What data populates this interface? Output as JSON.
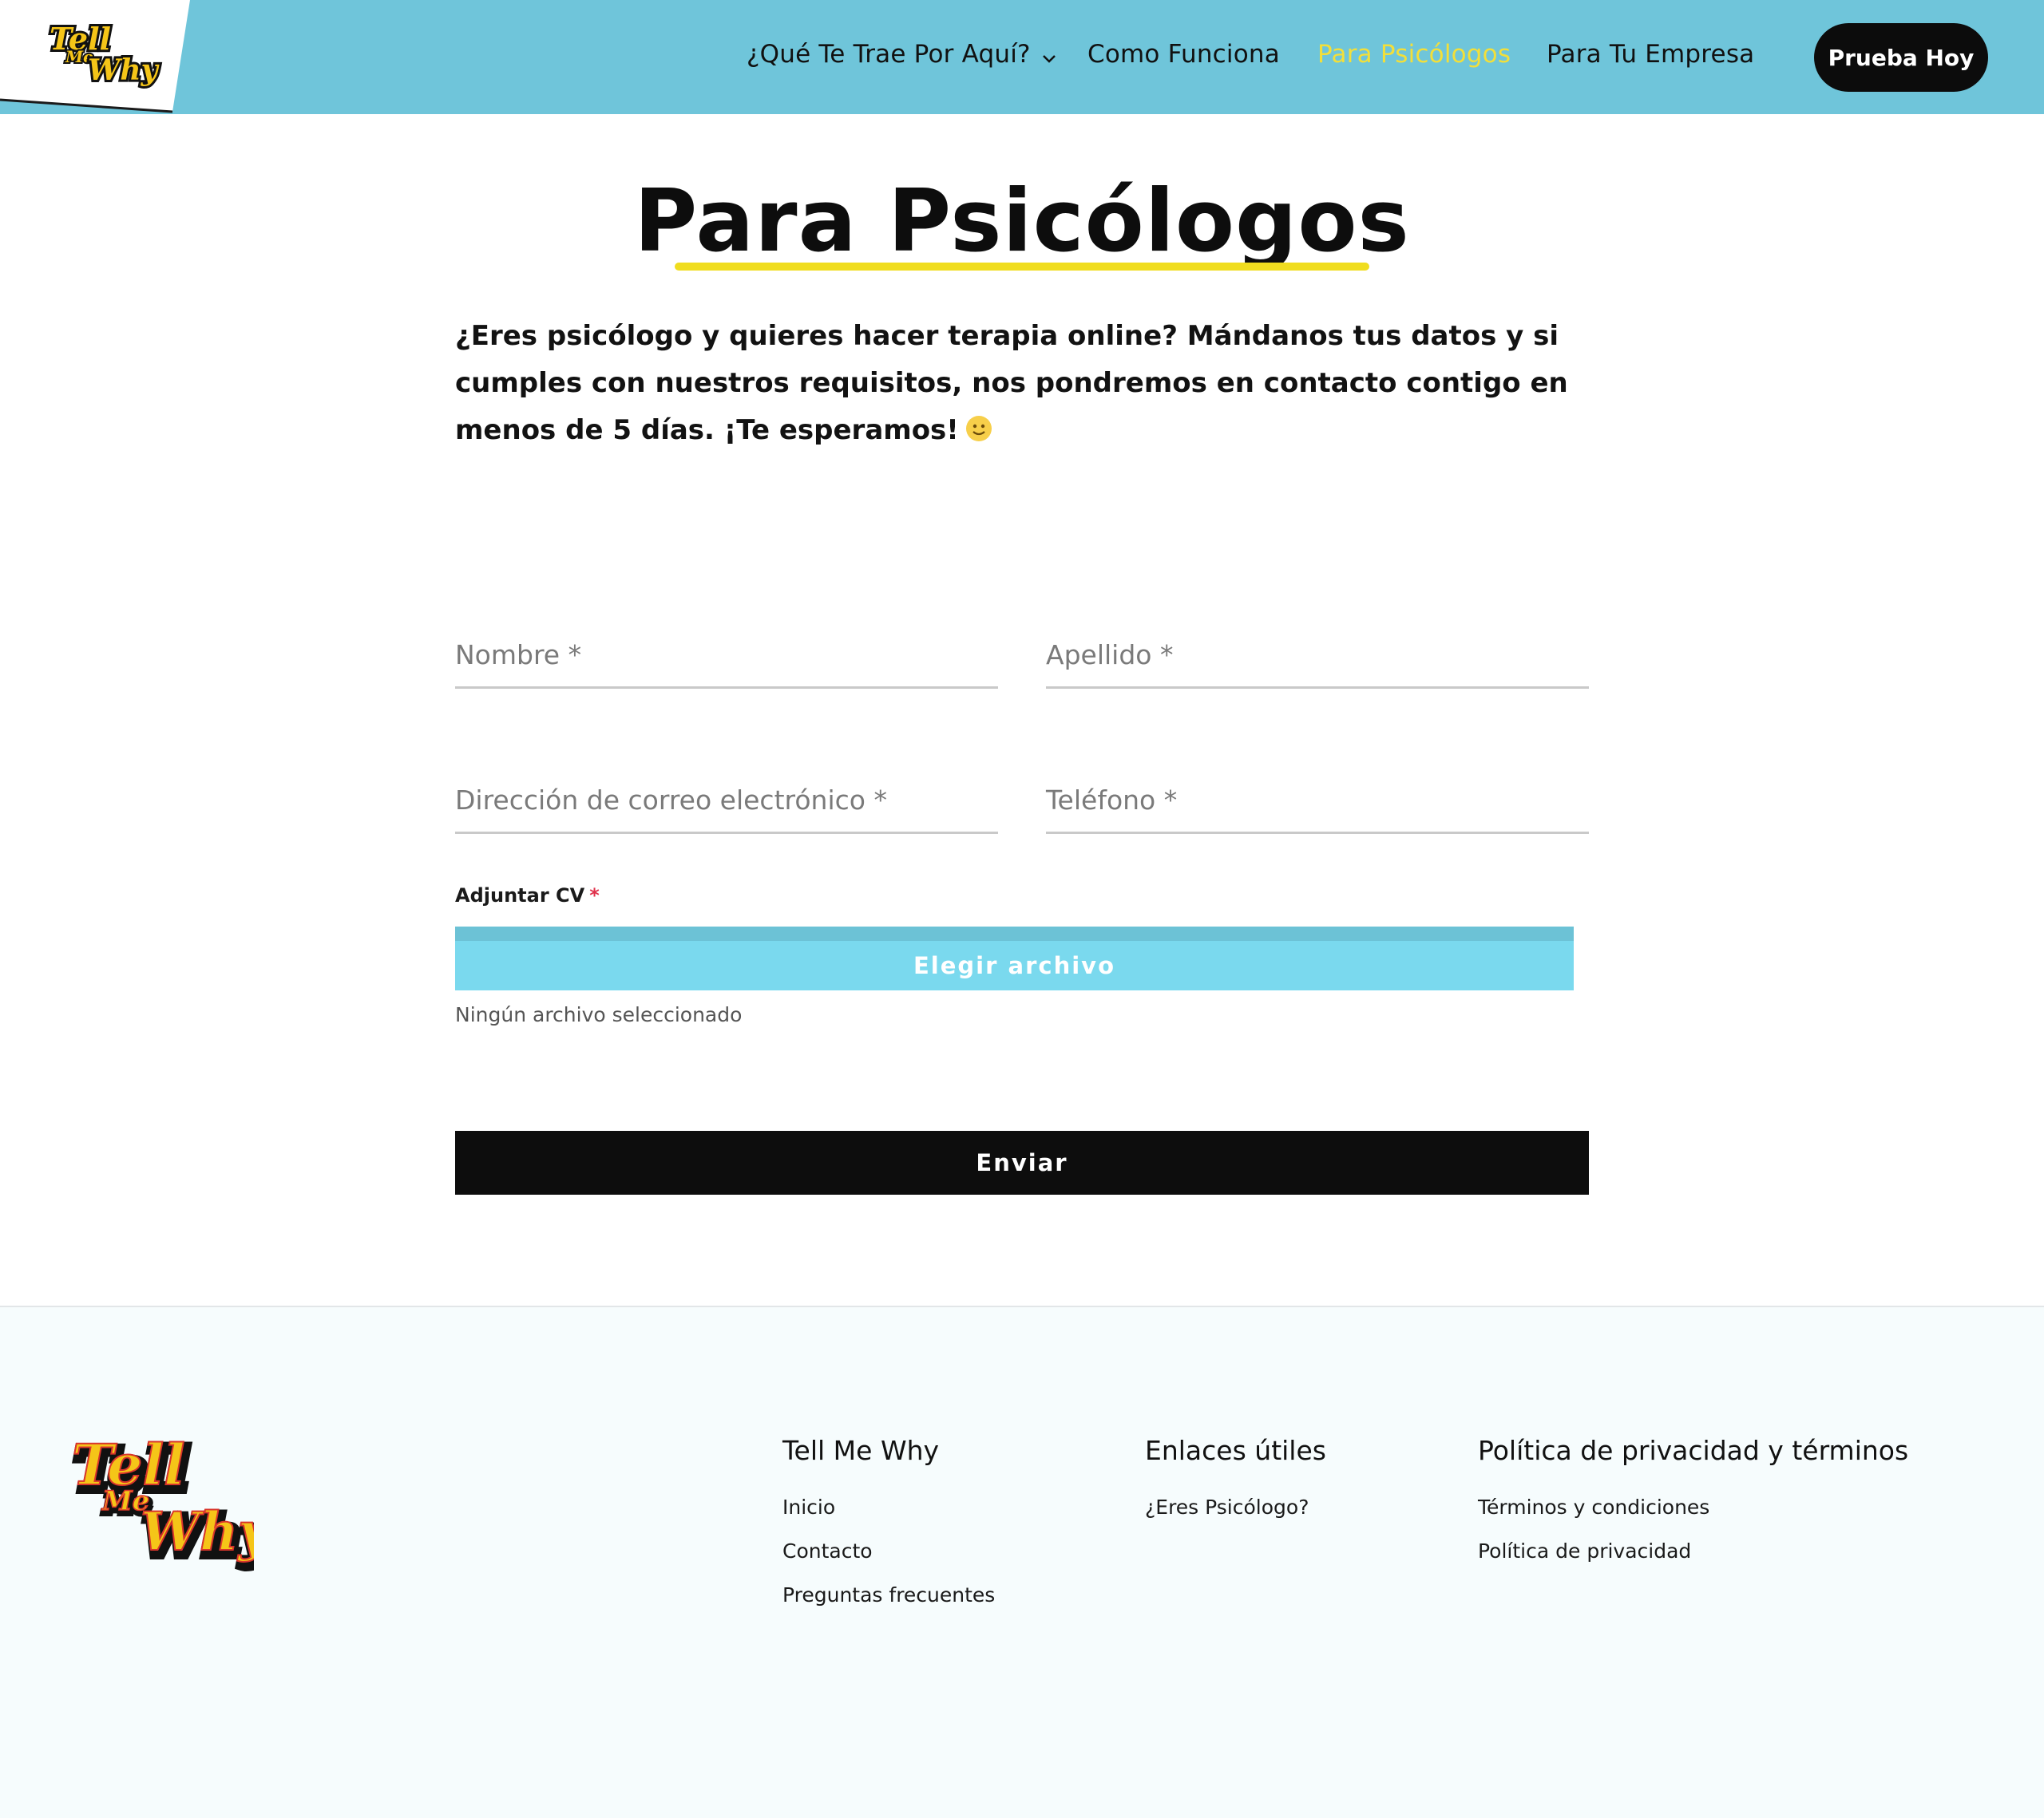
{
  "header": {
    "logo_text": "Tell Me Why",
    "nav": [
      {
        "label": "¿Qué Te Trae Por Aquí?",
        "has_dropdown": true
      },
      {
        "label": "Como Funciona"
      },
      {
        "label": "Para Psicólogos",
        "active": true
      },
      {
        "label": "Para Tu Empresa"
      }
    ],
    "cta_label": "Prueba Hoy"
  },
  "main": {
    "title": "Para Psicólogos",
    "intro": "¿Eres psicólogo y quieres hacer terapia online? Mándanos tus datos y si cumples con nuestros requisitos, nos pondremos en contacto contigo en menos de 5 días. ¡Te esperamos!"
  },
  "form": {
    "nombre_placeholder": "Nombre *",
    "apellido_placeholder": "Apellido *",
    "correo_placeholder": "Dirección de correo electrónico *",
    "telefono_placeholder": "Teléfono *",
    "cv_label": "Adjuntar CV",
    "cv_required_mark": "*",
    "file_button_label": "Elegir archivo",
    "file_status": "Ningún archivo seleccionado",
    "submit_label": "Enviar"
  },
  "footer": {
    "columns": [
      {
        "title": "Tell Me Why",
        "links": [
          "Inicio",
          "Contacto",
          "Preguntas frecuentes"
        ]
      },
      {
        "title": "Enlaces útiles",
        "links": [
          "¿Eres Psicólogo?"
        ]
      },
      {
        "title": "Política de privacidad y términos",
        "links": [
          "Términos y condiciones",
          "Política de privacidad"
        ]
      }
    ]
  },
  "colors": {
    "header_bg": "#6fc5da",
    "active_nav": "#f2df3a",
    "accent_yellow": "#f0dd1f",
    "file_button": "#7ad9ee",
    "dark": "#0d0d0d"
  }
}
